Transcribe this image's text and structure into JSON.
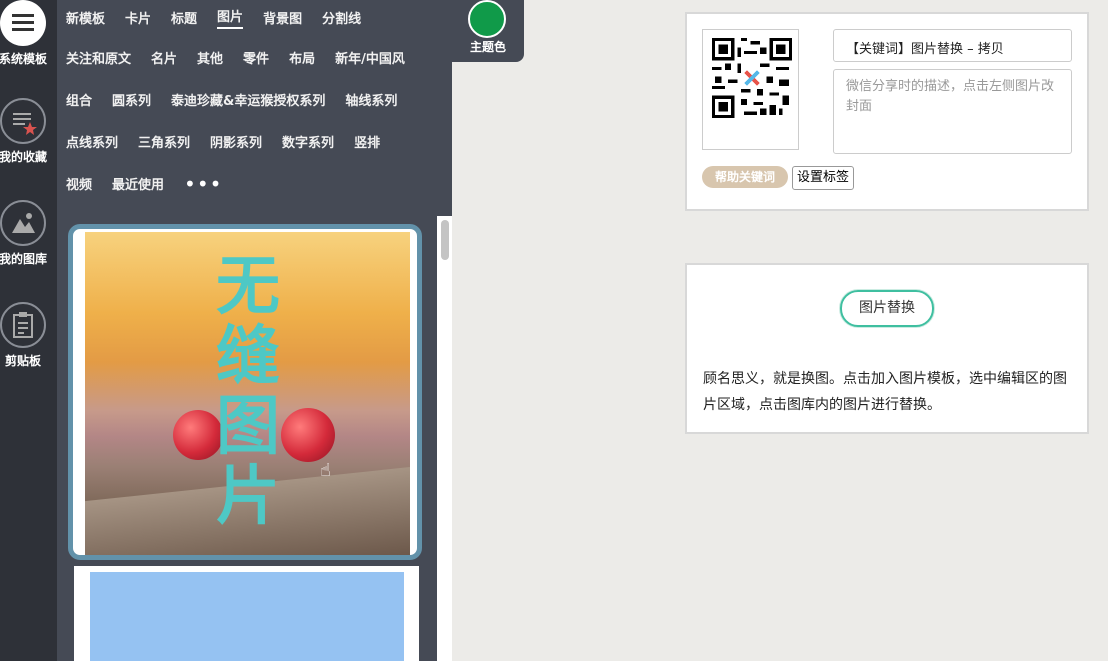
{
  "rail": {
    "items": [
      {
        "label": "系统模板",
        "icon": "menu-icon"
      },
      {
        "label": "我的收藏",
        "icon": "favorites-icon"
      },
      {
        "label": "我的图库",
        "icon": "gallery-icon"
      },
      {
        "label": "剪贴板",
        "icon": "clipboard-icon"
      }
    ]
  },
  "categories": {
    "rows": [
      [
        "新模板",
        "卡片",
        "标题",
        "图片",
        "背景图",
        "分割线"
      ],
      [
        "关注和原文",
        "名片",
        "其他",
        "零件",
        "布局",
        "新年/中国风"
      ],
      [
        "组合",
        "圆系列",
        "泰迪珍藏&幸运猴授权系列",
        "轴线系列"
      ],
      [
        "点线系列",
        "三角系列",
        "阴影系列",
        "数字系列",
        "竖排"
      ],
      [
        "视频",
        "最近使用"
      ]
    ],
    "active": "图片",
    "more": "•••"
  },
  "theme": {
    "label": "主题色",
    "color": "#109a49"
  },
  "template": {
    "overlay_text": [
      "无",
      "缝",
      "图",
      "片"
    ]
  },
  "share": {
    "title": "【关键词】图片替换 – 拷贝",
    "desc_placeholder": "微信分享时的描述，点击左侧图片改封面",
    "help_label": "帮助关键词",
    "tag_label": "设置标签"
  },
  "info": {
    "pill_label": "图片替换",
    "text": "顾名思义，就是换图。点击加入图片模板，选中编辑区的图片区域，点击图库内的图片进行替换。"
  },
  "colors": {
    "accent": "#3fbfa0",
    "rail": "#2e3138",
    "panel": "#454a55"
  }
}
